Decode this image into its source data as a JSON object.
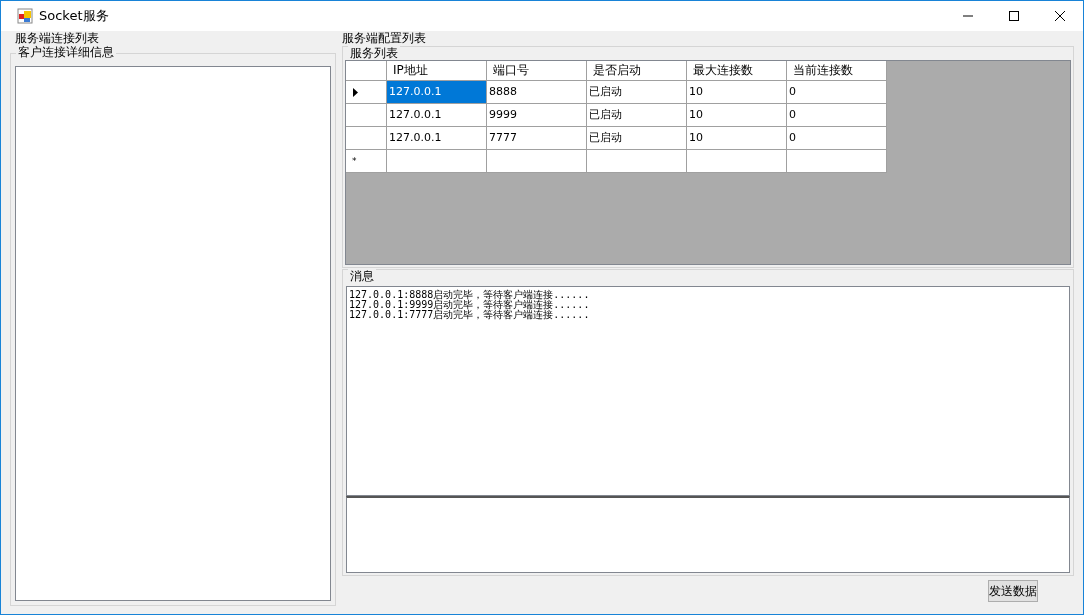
{
  "window": {
    "title": "Socket服务"
  },
  "left_panel": {
    "title": "服务端连接列表",
    "group_title": "客户连接详细信息"
  },
  "right_panel": {
    "title": "服务端配置列表",
    "group_title": "服务列表"
  },
  "table": {
    "columns": [
      "IP地址",
      "端口号",
      "是否启动",
      "最大连接数",
      "当前连接数"
    ],
    "rows": [
      {
        "selected": true,
        "cells": [
          "127.0.0.1",
          "8888",
          "已启动",
          "10",
          "0"
        ]
      },
      {
        "selected": false,
        "cells": [
          "127.0.0.1",
          "9999",
          "已启动",
          "10",
          "0"
        ]
      },
      {
        "selected": false,
        "cells": [
          "127.0.0.1",
          "7777",
          "已启动",
          "10",
          "0"
        ]
      }
    ],
    "new_row_marker": "*"
  },
  "messages": {
    "title": "消息",
    "lines": [
      "127.0.0.1:8888启动完毕，等待客户端连接......",
      "127.0.0.1:9999启动完毕，等待客户端连接......",
      "127.0.0.1:7777启动完毕，等待客户端连接......"
    ]
  },
  "send_button": "发送数据"
}
